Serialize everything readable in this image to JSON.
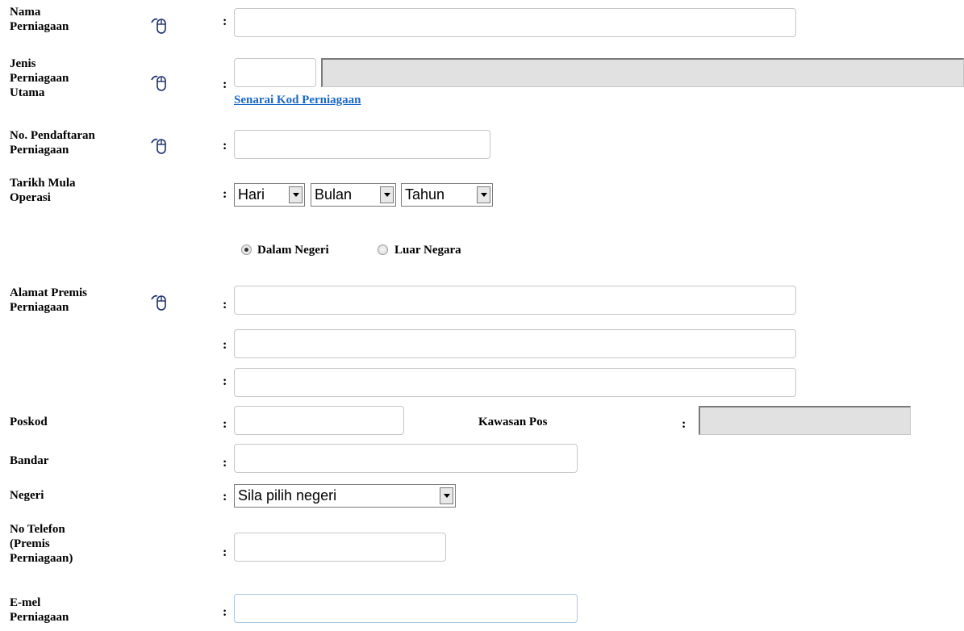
{
  "form": {
    "nama_perniagaan": {
      "label": "Nama\nPerniagaan",
      "value": ""
    },
    "jenis_perniagaan": {
      "label": "Jenis\nPerniagaan\nUtama",
      "code_value": "",
      "desc_value": "",
      "link": "Senarai Kod Perniagaan"
    },
    "no_pendaftaran": {
      "label": "No. Pendaftaran\nPerniagaan",
      "value": ""
    },
    "tarikh_mula": {
      "label": "Tarikh Mula\nOperasi",
      "hari": "Hari",
      "bulan": "Bulan",
      "tahun": "Tahun"
    },
    "lokasi": {
      "option1": "Dalam Negeri",
      "option2": "Luar Negara",
      "selected": "Dalam Negeri"
    },
    "alamat": {
      "label": "Alamat Premis\nPerniagaan",
      "line1": "",
      "line2": "",
      "line3": ""
    },
    "poskod": {
      "label": "Poskod",
      "value": ""
    },
    "kawasan_pos": {
      "label": "Kawasan Pos",
      "value": ""
    },
    "bandar": {
      "label": "Bandar",
      "value": ""
    },
    "negeri": {
      "label": "Negeri",
      "selected": "Sila pilih negeri"
    },
    "telefon": {
      "label": "No Telefon\n(Premis\nPerniagaan)",
      "value": ""
    },
    "emel": {
      "label": "E-mel\nPerniagaan",
      "value": ""
    }
  },
  "colon": ":",
  "icons": {
    "help": "mouse-pointer-icon"
  },
  "colors": {
    "link": "#1a67c8",
    "readonly_bg": "#e1e1e1",
    "focus_border": "#a9c6e2"
  }
}
